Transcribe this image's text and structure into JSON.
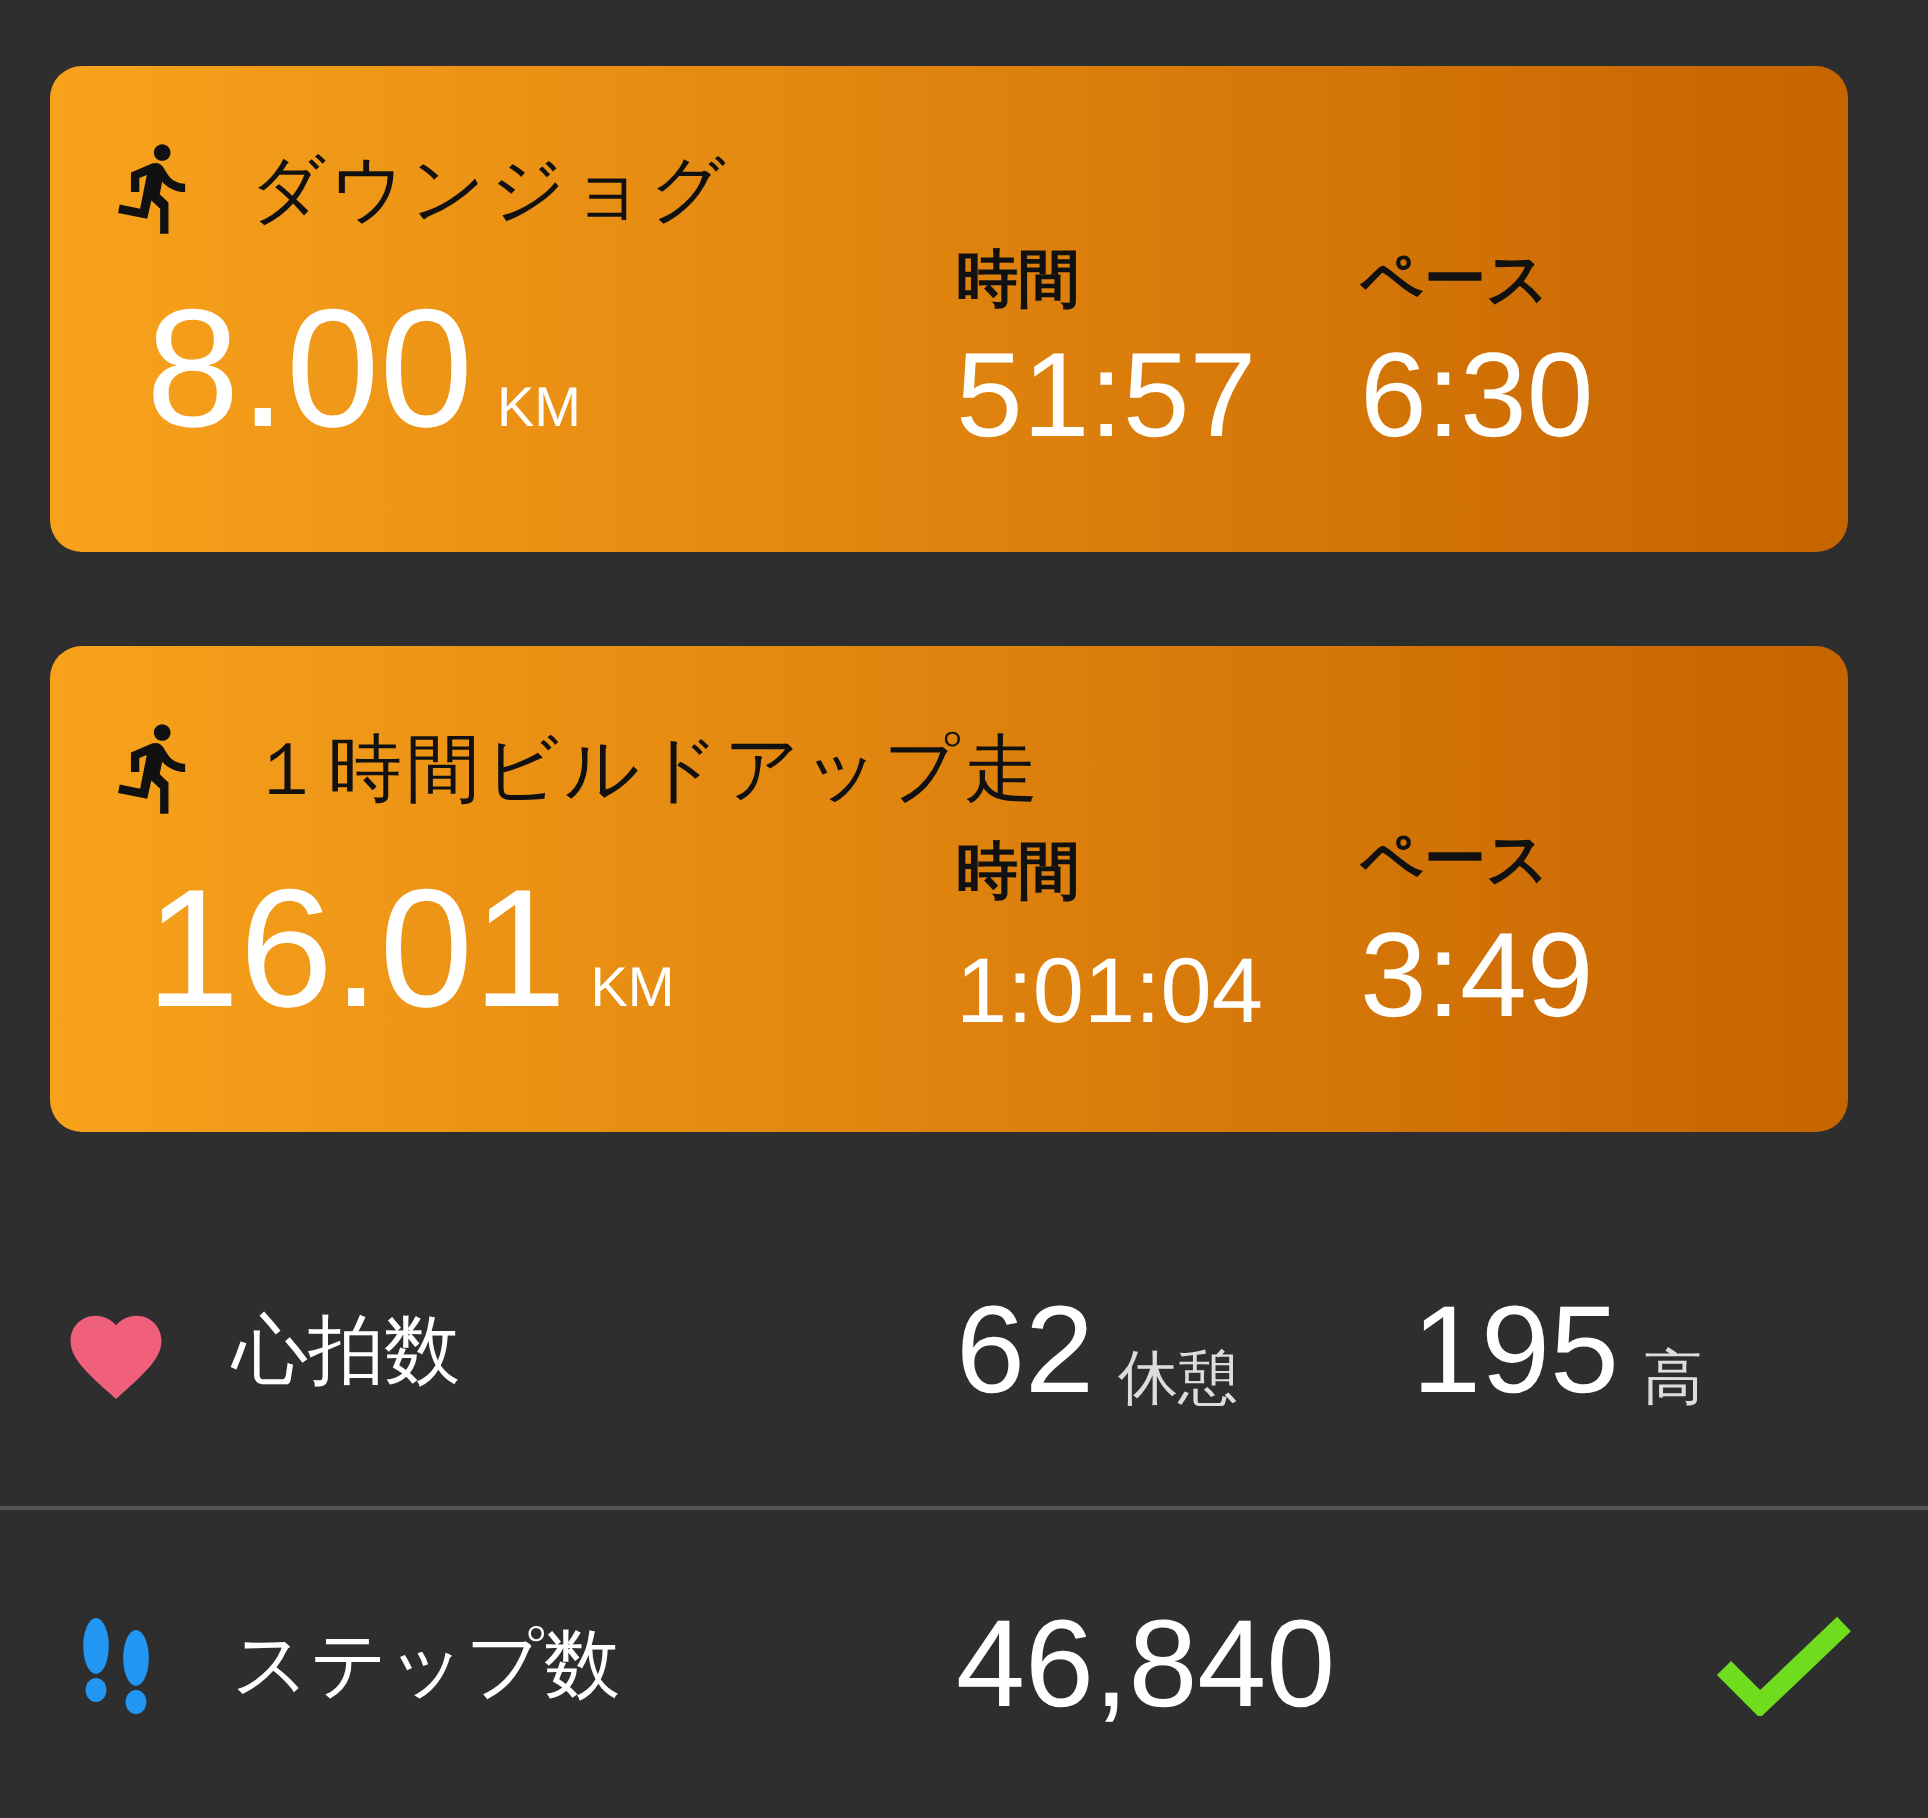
{
  "activities": [
    {
      "title": "ダウンジョグ",
      "distance": "8.00",
      "unit": "KM",
      "stats": [
        {
          "label": "時間",
          "value": "51:57",
          "kind": "normal"
        },
        {
          "label": "ペース",
          "value": "6:30",
          "kind": "normal"
        }
      ]
    },
    {
      "title": "１時間ビルドアップ走",
      "distance": "16.01",
      "unit": "KM",
      "stats": [
        {
          "label": "時間",
          "value": "1:01:04",
          "kind": "compact"
        },
        {
          "label": "ペース",
          "value": "3:49",
          "kind": "normal"
        }
      ]
    }
  ],
  "metrics": [
    {
      "kind": "heart",
      "label": "心拍数",
      "values": [
        {
          "value": "62",
          "unit": "休憩"
        },
        {
          "value": "195",
          "unit": "高"
        }
      ],
      "done": false
    },
    {
      "kind": "steps",
      "label": "ステップ数",
      "values": [
        {
          "value": "46,840"
        }
      ],
      "done": true
    }
  ]
}
